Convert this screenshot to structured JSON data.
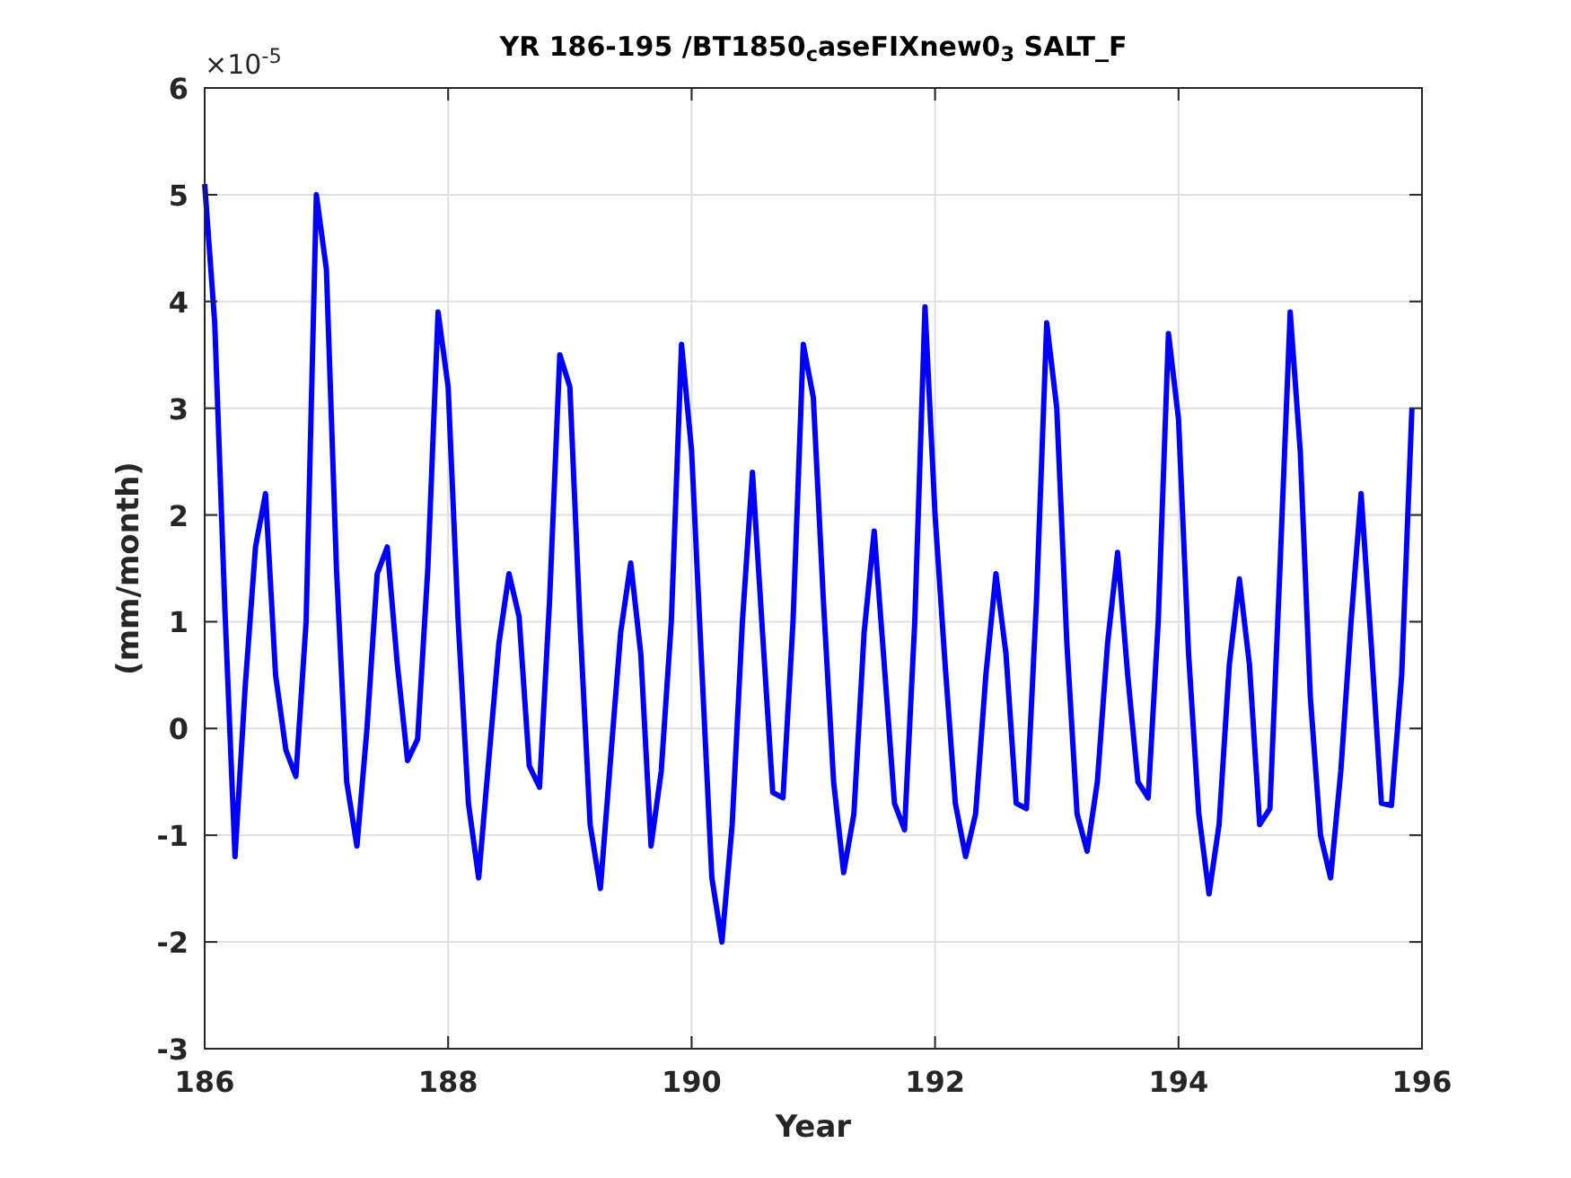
{
  "figure": {
    "chart_data": {
      "type": "line",
      "title": "YR 186-195 /BT1850$_{c}$aseFIXnew0$_{3}$ SALT_F",
      "xlabel": "Year",
      "ylabel": "(mm/month)",
      "x": [
        186,
        186.083,
        186.167,
        186.25,
        186.333,
        186.417,
        186.5,
        186.583,
        186.667,
        186.75,
        186.833,
        186.917,
        187,
        187.083,
        187.167,
        187.25,
        187.333,
        187.417,
        187.5,
        187.583,
        187.667,
        187.75,
        187.833,
        187.917,
        188,
        188.083,
        188.167,
        188.25,
        188.333,
        188.417,
        188.5,
        188.583,
        188.667,
        188.75,
        188.833,
        188.917,
        189,
        189.083,
        189.167,
        189.25,
        189.333,
        189.417,
        189.5,
        189.583,
        189.667,
        189.75,
        189.833,
        189.917,
        190,
        190.083,
        190.167,
        190.25,
        190.333,
        190.417,
        190.5,
        190.583,
        190.667,
        190.75,
        190.833,
        190.917,
        191,
        191.083,
        191.167,
        191.25,
        191.333,
        191.417,
        191.5,
        191.583,
        191.667,
        191.75,
        191.833,
        191.917,
        192,
        192.083,
        192.167,
        192.25,
        192.333,
        192.417,
        192.5,
        192.583,
        192.667,
        192.75,
        192.833,
        192.917,
        193,
        193.083,
        193.167,
        193.25,
        193.333,
        193.417,
        193.5,
        193.583,
        193.667,
        193.75,
        193.833,
        193.917,
        194,
        194.083,
        194.167,
        194.25,
        194.333,
        194.417,
        194.5,
        194.583,
        194.667,
        194.75,
        194.833,
        194.917,
        195,
        195.083,
        195.167,
        195.25,
        195.333,
        195.417,
        195.5,
        195.583,
        195.667,
        195.75,
        195.833,
        195.917
      ],
      "series": [
        {
          "color": "#0000ff",
          "values": [
            5.1,
            3.8,
            1.1,
            -1.2,
            0.4,
            1.7,
            2.2,
            0.5,
            -0.2,
            -0.45,
            1.0,
            5.0,
            4.3,
            1.5,
            -0.5,
            -1.1,
            0.0,
            1.45,
            1.7,
            0.6,
            -0.3,
            -0.1,
            1.5,
            3.9,
            3.2,
            1.0,
            -0.7,
            -1.4,
            -0.3,
            0.8,
            1.45,
            1.05,
            -0.35,
            -0.55,
            1.2,
            3.5,
            3.2,
            1.0,
            -0.9,
            -1.5,
            -0.3,
            0.9,
            1.55,
            0.7,
            -1.1,
            -0.4,
            1.0,
            3.6,
            2.6,
            0.6,
            -1.4,
            -2.0,
            -0.9,
            1.0,
            2.4,
            0.9,
            -0.6,
            -0.65,
            1.0,
            3.6,
            3.1,
            1.2,
            -0.5,
            -1.35,
            -0.8,
            0.9,
            1.85,
            0.6,
            -0.7,
            -0.95,
            1.0,
            3.95,
            2.0,
            0.6,
            -0.7,
            -1.2,
            -0.8,
            0.5,
            1.45,
            0.7,
            -0.7,
            -0.75,
            1.2,
            3.8,
            3.0,
            0.8,
            -0.8,
            -1.15,
            -0.5,
            0.8,
            1.65,
            0.5,
            -0.5,
            -0.65,
            1.0,
            3.7,
            2.9,
            0.7,
            -0.8,
            -1.55,
            -0.9,
            0.6,
            1.4,
            0.6,
            -0.9,
            -0.75,
            1.5,
            3.9,
            2.6,
            0.3,
            -1.0,
            -1.4,
            -0.4,
            1.0,
            2.2,
            0.8,
            -0.7,
            -0.72,
            0.5,
            3.0
          ]
        }
      ],
      "grid": true,
      "xlim": [
        186,
        196
      ],
      "ylim": [
        -3,
        6
      ],
      "xticks": [
        186,
        188,
        190,
        192,
        194,
        196
      ],
      "yticks": [
        -3,
        -2,
        -1,
        0,
        1,
        2,
        3,
        4,
        5,
        6
      ]
    },
    "y_multiplier": "×10$^{-5}$"
  }
}
